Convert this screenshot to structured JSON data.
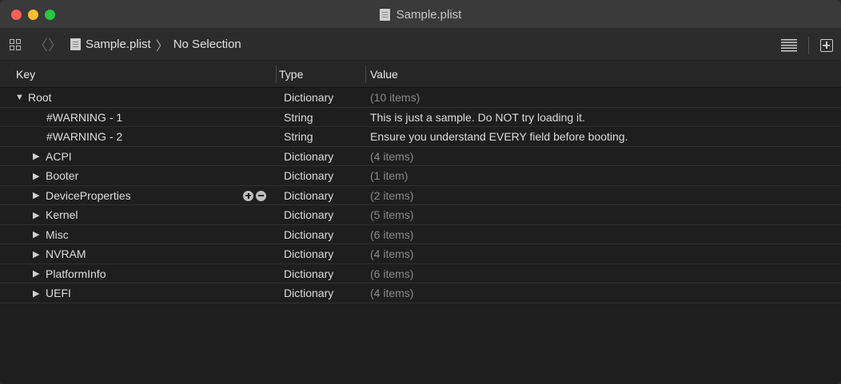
{
  "window": {
    "title": "Sample.plist"
  },
  "pathbar": {
    "file": "Sample.plist",
    "separator": "〉",
    "selection": "No Selection",
    "back_icon": "chevron-left-icon",
    "forward_icon": "chevron-right-icon"
  },
  "columns": {
    "key": "Key",
    "type": "Type",
    "value": "Value"
  },
  "rows": [
    {
      "key": "Root",
      "type": "Dictionary",
      "value": "(10 items)",
      "indent": 0,
      "disclosure": "expanded",
      "dim": true
    },
    {
      "key": "#WARNING - 1",
      "type": "String",
      "value": "This is just a sample. Do NOT try loading it.",
      "indent": 1,
      "disclosure": "none",
      "dim": false
    },
    {
      "key": "#WARNING - 2",
      "type": "String",
      "value": "Ensure you understand EVERY field before booting.",
      "indent": 1,
      "disclosure": "none",
      "dim": false
    },
    {
      "key": "ACPI",
      "type": "Dictionary",
      "value": "(4 items)",
      "indent": 1,
      "disclosure": "collapsed",
      "dim": true
    },
    {
      "key": "Booter",
      "type": "Dictionary",
      "value": "(1 item)",
      "indent": 1,
      "disclosure": "collapsed",
      "dim": true
    },
    {
      "key": "DeviceProperties",
      "type": "Dictionary",
      "value": "(2 items)",
      "indent": 1,
      "disclosure": "collapsed",
      "dim": true,
      "hover_buttons": true
    },
    {
      "key": "Kernel",
      "type": "Dictionary",
      "value": "(5 items)",
      "indent": 1,
      "disclosure": "collapsed",
      "dim": true
    },
    {
      "key": "Misc",
      "type": "Dictionary",
      "value": "(6 items)",
      "indent": 1,
      "disclosure": "collapsed",
      "dim": true
    },
    {
      "key": "NVRAM",
      "type": "Dictionary",
      "value": "(4 items)",
      "indent": 1,
      "disclosure": "collapsed",
      "dim": true
    },
    {
      "key": "PlatformInfo",
      "type": "Dictionary",
      "value": "(6 items)",
      "indent": 1,
      "disclosure": "collapsed",
      "dim": true
    },
    {
      "key": "UEFI",
      "type": "Dictionary",
      "value": "(4 items)",
      "indent": 1,
      "disclosure": "collapsed",
      "dim": true
    }
  ],
  "glyphs": {
    "expanded": "▼",
    "collapsed": "▶",
    "back": "〈",
    "forward": "〉"
  }
}
